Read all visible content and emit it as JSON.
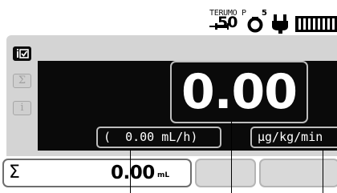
{
  "status_bar": {
    "pump_brand": "TERUMO P",
    "syringe_size": "50",
    "line_indicator": "5",
    "icons": [
      "syringe-icon",
      "infusion-line-icon",
      "ac-power-plug-icon",
      "battery-icon"
    ]
  },
  "sidebar": {
    "tabs": [
      {
        "name": "info-check-tab",
        "glyph": "i☑",
        "active": true
      },
      {
        "name": "total-volume-tab",
        "glyph": "Σ",
        "active": false
      },
      {
        "name": "information-tab",
        "glyph": "i",
        "active": false
      }
    ]
  },
  "display": {
    "rate_value": "0.00",
    "flow_rate_text": "(  0.00 mL/h)",
    "dose_unit": "μg/kg/min"
  },
  "bottom_bar": {
    "sigma_label": "Σ",
    "volume_value": "0.00",
    "volume_unit": "mL"
  },
  "colors": {
    "display_background": "#0a0a0a",
    "panel_background": "#d4d4d4",
    "field_border": "#bdbdbd",
    "text_on_display": "#ffffff"
  }
}
